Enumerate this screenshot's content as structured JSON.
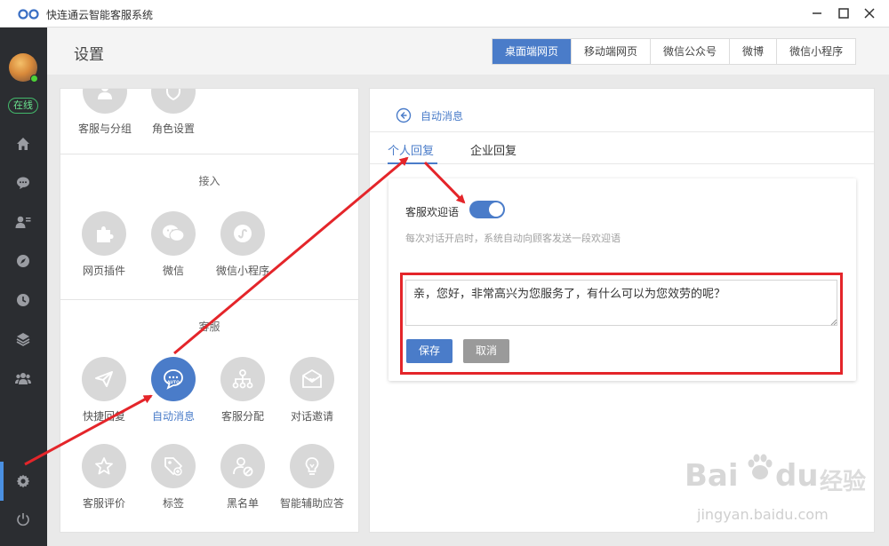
{
  "window": {
    "title": "快连通云智能客服系统"
  },
  "sidebar": {
    "status": "在线",
    "items": [
      {
        "icon": "home-icon"
      },
      {
        "icon": "chat-icon"
      },
      {
        "icon": "contacts-icon"
      },
      {
        "icon": "compass-icon"
      },
      {
        "icon": "clock-icon"
      },
      {
        "icon": "layers-icon"
      },
      {
        "icon": "team-icon"
      },
      {
        "icon": "settings-icon",
        "active": true
      },
      {
        "icon": "power-icon"
      }
    ]
  },
  "header": {
    "title": "设置",
    "tabs": [
      "桌面端网页",
      "移动端网页",
      "微信公众号",
      "微博",
      "微信小程序"
    ],
    "active_tab": "桌面端网页"
  },
  "left_panel": {
    "top_items": [
      "客服与分组",
      "角色设置"
    ],
    "sections": [
      {
        "title": "接入",
        "items": [
          "网页插件",
          "微信",
          "微信小程序"
        ]
      },
      {
        "title": "客服",
        "items": [
          "快捷回复",
          "自动消息",
          "客服分配",
          "对话邀请",
          "客服评价",
          "标签",
          "黑名单",
          "智能辅助应答"
        ]
      }
    ],
    "active_item": "自动消息"
  },
  "right_panel": {
    "back_label": "自动消息",
    "sub_tabs": [
      "个人回复",
      "企业回复"
    ],
    "active_sub_tab": "个人回复",
    "welcome_label": "客服欢迎语",
    "welcome_enabled": true,
    "hint": "每次对话开启时，系统自动向顾客发送一段欢迎语",
    "message": "亲，您好，非常高兴为您服务了，有什么可以为您效劳的呢？",
    "save_label": "保存",
    "cancel_label": "取消"
  },
  "watermark": {
    "brand": "Bai",
    "brand2": "du",
    "cn": "经验",
    "url": "jingyan.baidu.com"
  },
  "colors": {
    "accent": "#4a7cc9",
    "sidebar_bg": "#2b2d31",
    "annotation_red": "#e4252a",
    "online_green": "#43b96b"
  }
}
